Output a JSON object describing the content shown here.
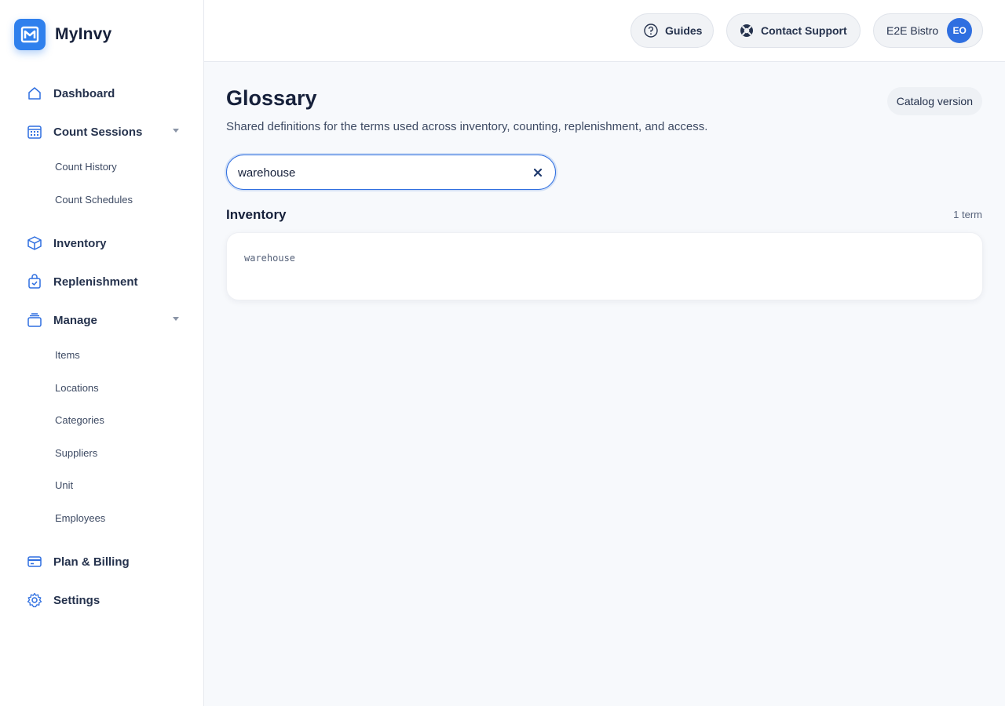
{
  "brand": {
    "name": "MyInvy",
    "icon": "logo-icon",
    "color": "#2f80ed"
  },
  "sidebar": {
    "items": [
      {
        "label": "Dashboard",
        "icon": "home-icon"
      },
      {
        "label": "Count Sessions",
        "icon": "calendar-icon",
        "expanded": true,
        "children": [
          {
            "label": "Count History"
          },
          {
            "label": "Count Schedules"
          }
        ]
      },
      {
        "label": "Inventory",
        "icon": "box-icon"
      },
      {
        "label": "Replenishment",
        "icon": "bag-check-icon"
      },
      {
        "label": "Manage",
        "icon": "tray-icon",
        "expanded": true,
        "children": [
          {
            "label": "Items"
          },
          {
            "label": "Locations"
          },
          {
            "label": "Categories"
          },
          {
            "label": "Suppliers"
          },
          {
            "label": "Unit"
          },
          {
            "label": "Employees"
          }
        ]
      },
      {
        "label": "Plan & Billing",
        "icon": "credit-card-icon"
      },
      {
        "label": "Settings",
        "icon": "gear-icon"
      }
    ]
  },
  "topbar": {
    "guides_label": "Guides",
    "support_label": "Contact Support",
    "account_label": "E2E Bistro",
    "avatar_initials": "EO"
  },
  "main": {
    "title": "Glossary",
    "subtitle": "Shared definitions for the terms used across inventory, counting, replenishment, and access.",
    "catalog_label": "Catalog version",
    "search": {
      "value": "warehouse"
    },
    "sections": [
      {
        "title": "Inventory",
        "count": "1 term",
        "terms": [
          {
            "name": "warehouse"
          }
        ]
      }
    ]
  },
  "colors": {
    "accent": "#2f6fe0",
    "icon": "#2f6fe0"
  }
}
